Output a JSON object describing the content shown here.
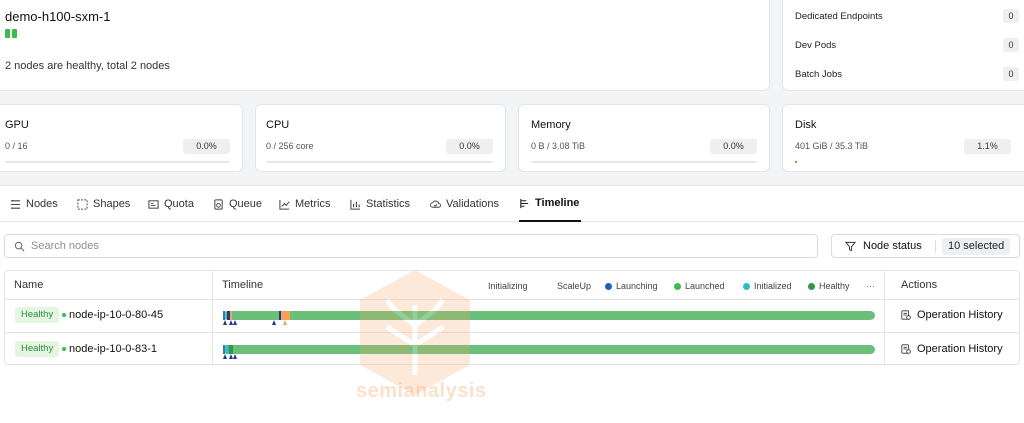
{
  "cluster": {
    "name": "demo-h100-sxm-1",
    "health_dots": 2,
    "summary": "2 nodes are healthy, total 2 nodes"
  },
  "workloads": [
    {
      "label": "Dedicated Endpoints",
      "count": "0"
    },
    {
      "label": "Dev Pods",
      "count": "0"
    },
    {
      "label": "Batch Jobs",
      "count": "0"
    }
  ],
  "resources": {
    "gpu": {
      "title": "GPU",
      "value": "0 / 16",
      "percent": "0.0%",
      "fill": 0.0
    },
    "cpu": {
      "title": "CPU",
      "value": "0 / 256 core",
      "percent": "0.0%",
      "fill": 0.0
    },
    "memory": {
      "title": "Memory",
      "value": "0 B / 3.08 TiB",
      "percent": "0.0%",
      "fill": 0.0
    },
    "disk": {
      "title": "Disk",
      "value": "401 GiB / 35.3 TiB",
      "percent": "1.1%",
      "fill": 0.011
    }
  },
  "tabs": [
    {
      "label": "Nodes",
      "icon": "nodes-icon"
    },
    {
      "label": "Shapes",
      "icon": "shapes-icon"
    },
    {
      "label": "Quota",
      "icon": "quota-icon"
    },
    {
      "label": "Queue",
      "icon": "queue-icon"
    },
    {
      "label": "Metrics",
      "icon": "metrics-icon"
    },
    {
      "label": "Statistics",
      "icon": "statistics-icon"
    },
    {
      "label": "Validations",
      "icon": "validations-icon"
    },
    {
      "label": "Timeline",
      "icon": "timeline-icon",
      "active": true
    }
  ],
  "search": {
    "placeholder": "Search nodes"
  },
  "status_filter": {
    "label": "Node status",
    "selected": "10 selected"
  },
  "table": {
    "headers": {
      "name": "Name",
      "timeline": "Timeline",
      "actions": "Actions"
    },
    "legend": [
      {
        "label": "Initializing",
        "color": ""
      },
      {
        "label": "ScaleUp",
        "color": ""
      },
      {
        "label": "Launching",
        "color": "#1f5fc4"
      },
      {
        "label": "Launched",
        "color": "#3dbb4b"
      },
      {
        "label": "Initialized",
        "color": "#2bbfc0"
      },
      {
        "label": "Healthy",
        "color": "#2e9a45"
      }
    ],
    "legend_more": "···",
    "rows": [
      {
        "status": "Healthy",
        "name": "node-ip-10-0-80-45",
        "action": "Operation History"
      },
      {
        "status": "Healthy",
        "name": "node-ip-10-0-83-1",
        "action": "Operation History"
      }
    ]
  },
  "colors": {
    "healthy": "#3dbb4b",
    "timeline_bar": "#6abf79",
    "badge_bg": "#e4f6e2",
    "badge_text": "#2e8b3a",
    "scaleup_segment": "#f5a15a"
  },
  "watermark": "semianalysis"
}
